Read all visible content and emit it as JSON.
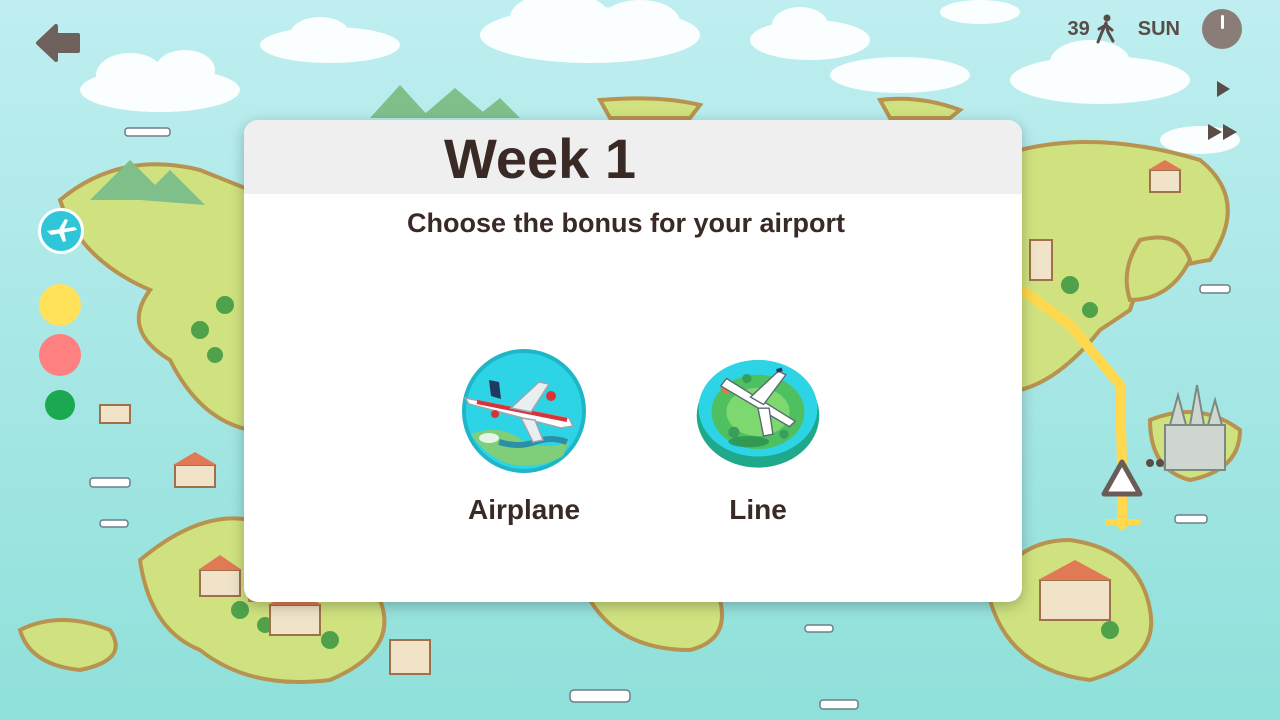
{
  "hud": {
    "passenger_count": "39",
    "day": "SUN",
    "icons": [
      "back-arrow-icon",
      "walking-person-icon",
      "clock-icon",
      "play-icon",
      "fast-forward-icon"
    ]
  },
  "line_picker": {
    "items": [
      {
        "name": "airplane",
        "color": "#2fc6d8"
      },
      {
        "name": "yellow",
        "color": "#ffe25a"
      },
      {
        "name": "red",
        "color": "#ff8080"
      },
      {
        "name": "green",
        "color": "#1aa851"
      }
    ]
  },
  "dialog": {
    "title": "Week 1",
    "subtitle": "Choose the bonus for your airport",
    "options": [
      {
        "label": "Airplane",
        "icon": "airplane-icon"
      },
      {
        "label": "Line",
        "icon": "airport-line-icon"
      }
    ]
  },
  "colors": {
    "sea": "#7fd9d3",
    "land": "#cfe27f",
    "route_line": "#ffd84d",
    "text": "#3a2a26"
  }
}
